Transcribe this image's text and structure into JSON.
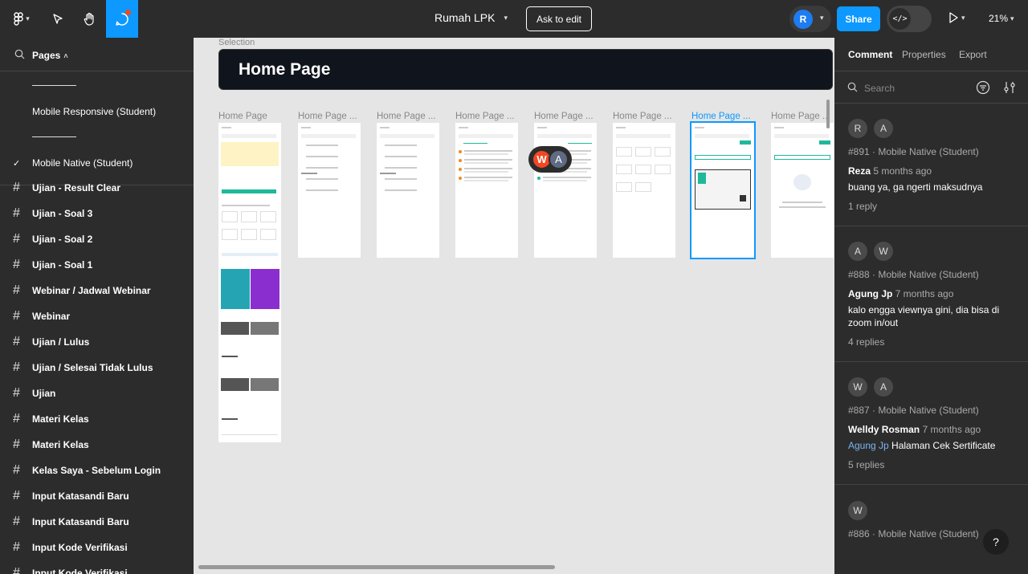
{
  "toolbar": {
    "file_title": "Rumah LPK",
    "ask_to_edit": "Ask to edit",
    "user_initial": "R",
    "share": "Share",
    "dev_mode_glyph": "</>",
    "zoom": "21%",
    "accent_color": "#0d99ff"
  },
  "left_panel": {
    "pages_title": "Pages",
    "pages": [
      {
        "label": "Mobile Responsive (Student)",
        "selected": false
      },
      {
        "label": "Mobile Native (Student)",
        "selected": true
      }
    ],
    "layers": [
      "Ujian - Result Clear",
      "Ujian - Soal 3",
      "Ujian - Soal 2",
      "Ujian - Soal 1",
      "Webinar / Jadwal Webinar",
      "Webinar",
      "Ujian / Lulus",
      "Ujian / Selesai Tidak Lulus",
      "Ujian",
      "Materi Kelas",
      "Materi Kelas",
      "Kelas Saya - Sebelum Login",
      "Input Katasandi Baru",
      "Input Katasandi Baru",
      "Input Kode Verifikasi",
      "Input Kode Verifikasi"
    ]
  },
  "canvas": {
    "selection_label": "Selection",
    "section_title": "Home Page",
    "frames": [
      {
        "label": "Home Page"
      },
      {
        "label": "Home Page ..."
      },
      {
        "label": "Home Page ..."
      },
      {
        "label": "Home Page ..."
      },
      {
        "label": "Home Page ..."
      },
      {
        "label": "Home Page ..."
      },
      {
        "label": "Home Page ...",
        "selected": true
      },
      {
        "label": "Home Page ..."
      }
    ],
    "collaborators": [
      "W",
      "A"
    ]
  },
  "right_panel": {
    "tabs": [
      "Comment",
      "Properties",
      "Export"
    ],
    "search_placeholder": "Search",
    "comments": [
      {
        "avatars": [
          "R",
          "A"
        ],
        "meta": "#891 · Mobile Native (Student)",
        "author": "Reza",
        "time": "5 months ago",
        "body": "buang ya, ga ngerti maksudnya",
        "replies": "1 reply"
      },
      {
        "avatars": [
          "A",
          "W"
        ],
        "meta": "#888 · Mobile Native (Student)",
        "author": "Agung Jp",
        "time": "7 months ago",
        "body": "kalo engga viewnya gini, dia bisa di zoom in/out",
        "replies": "4 replies"
      },
      {
        "avatars": [
          "W",
          "A"
        ],
        "meta": "#887 · Mobile Native (Student)",
        "author": "Welldy Rosman",
        "time": "7 months ago",
        "mention": "Agung Jp",
        "body": " Halaman Cek Sertificate",
        "replies": "5 replies"
      },
      {
        "avatars": [
          "W"
        ],
        "meta": "#886 · Mobile Native (Student)"
      }
    ],
    "help": "?"
  }
}
